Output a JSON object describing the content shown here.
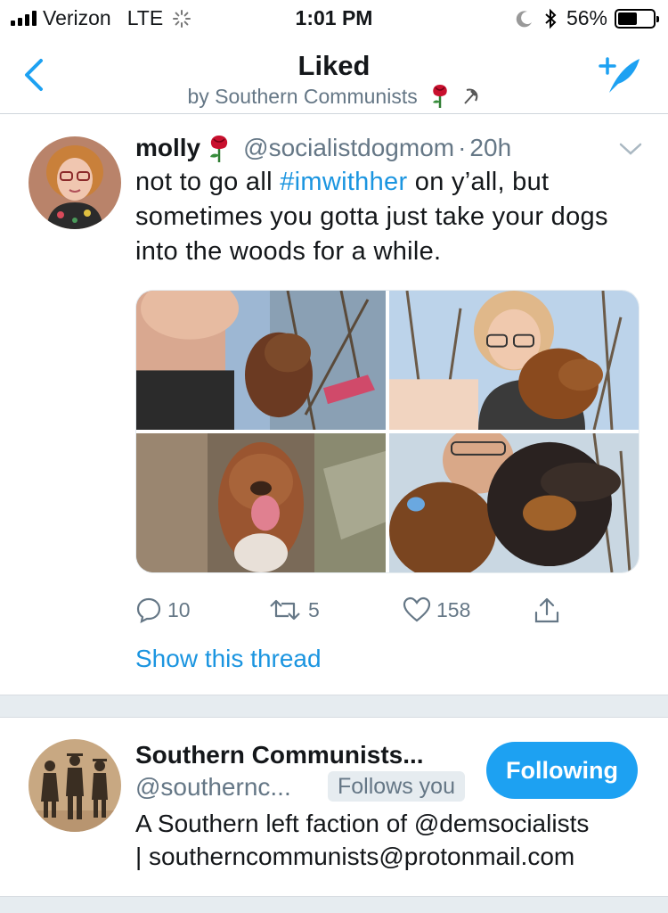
{
  "status_bar": {
    "carrier": "Verizon",
    "network": "LTE",
    "time": "1:01 PM",
    "battery_percent": "56%",
    "battery_level": 0.56,
    "icons": [
      "signal-icon",
      "loading-icon",
      "moon-icon",
      "bluetooth-icon",
      "battery-icon"
    ]
  },
  "nav": {
    "title": "Liked",
    "subtitle": "by Southern Communists",
    "icons": [
      "back-arrow-icon",
      "rose-icon",
      "hammer-sickle-icon",
      "compose-tweet-icon"
    ]
  },
  "tweet": {
    "name": "molly",
    "handle": "@socialistdogmom",
    "separator": "·",
    "time": "20h",
    "text_before": "not to go all ",
    "hashtag": "#imwithher",
    "text_after": " on y’all, but sometimes you gotta just take your dogs into the woods for a while.",
    "photo_count": 4,
    "replies": "10",
    "retweets": "5",
    "likes": "158",
    "show_thread": "Show this thread",
    "colors": {
      "link": "#1b95e0",
      "muted": "#657786"
    }
  },
  "user_card": {
    "name": "Southern Communists...",
    "handle": "@southernc...",
    "follows_you": "Follows you",
    "follow_button": "Following",
    "bio_part1": "A Southern left faction of @demsocialists",
    "bio_part2": "| southerncommunists@protonmail.com",
    "colors": {
      "button": "#1da1f2"
    }
  }
}
